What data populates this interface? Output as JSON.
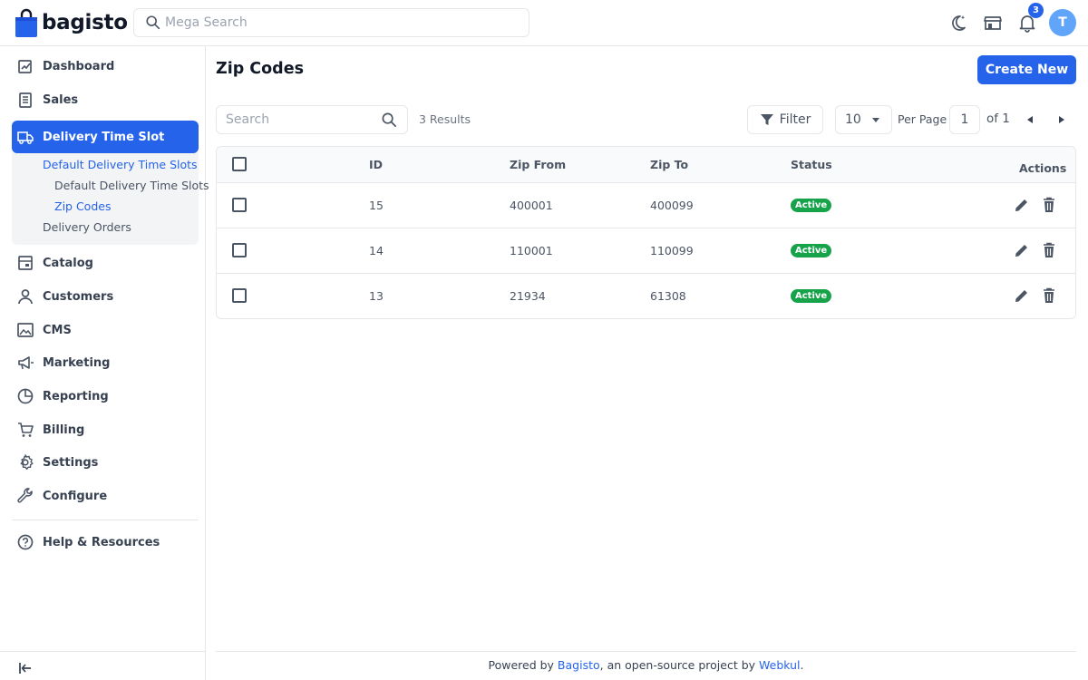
{
  "header": {
    "brand": "bagisto",
    "search_placeholder": "Mega Search",
    "notification_count": "3",
    "avatar_initial": "T",
    "icons": [
      "dark-mode-icon",
      "storefront-icon",
      "bell-icon"
    ]
  },
  "sidebar": {
    "items": [
      {
        "label": "Dashboard",
        "icon": "dashboard-icon"
      },
      {
        "label": "Sales",
        "icon": "sales-icon"
      },
      {
        "label": "Delivery Time Slot",
        "icon": "delivery-icon"
      },
      {
        "label": "Catalog",
        "icon": "catalog-icon"
      },
      {
        "label": "Customers",
        "icon": "customers-icon"
      },
      {
        "label": "CMS",
        "icon": "cms-icon"
      },
      {
        "label": "Marketing",
        "icon": "marketing-icon"
      },
      {
        "label": "Reporting",
        "icon": "reporting-icon"
      },
      {
        "label": "Billing",
        "icon": "billing-icon"
      },
      {
        "label": "Settings",
        "icon": "settings-icon"
      },
      {
        "label": "Configure",
        "icon": "configure-icon"
      },
      {
        "label": "Help & Resources",
        "icon": "help-icon"
      }
    ],
    "subitems": [
      {
        "label": "Default Delivery Time Slots"
      },
      {
        "label": "Default Delivery Time Slots"
      },
      {
        "label": "Zip Codes"
      },
      {
        "label": "Delivery Orders"
      }
    ]
  },
  "main": {
    "title": "Zip Codes",
    "create_label": "Create New",
    "search_placeholder": "Search",
    "results": "3 Results",
    "filter_label": "Filter",
    "per_page_value": "10",
    "per_page_label": "Per Page",
    "page": "1",
    "of_pages": "of 1"
  },
  "table": {
    "columns": {
      "id": "ID",
      "from": "Zip From",
      "to": "Zip To",
      "status": "Status",
      "actions": "Actions"
    },
    "rows": [
      {
        "id": "15",
        "from": "400001",
        "to": "400099",
        "status": "Active"
      },
      {
        "id": "14",
        "from": "110001",
        "to": "110099",
        "status": "Active"
      },
      {
        "id": "13",
        "from": "21934",
        "to": "61308",
        "status": "Active"
      }
    ]
  },
  "footer": {
    "prefix": "Powered by ",
    "link1": "Bagisto",
    "middle": ", an open-source project by ",
    "link2": "Webkul",
    "suffix": "."
  },
  "colors": {
    "accent": "#2563eb",
    "active_badge": "#16a34a"
  }
}
